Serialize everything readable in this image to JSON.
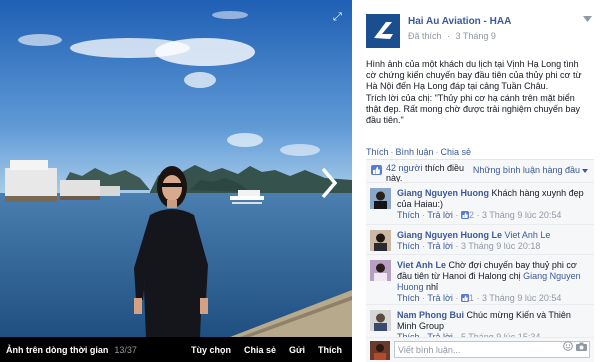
{
  "photo": {
    "album_link": "Ảnh trên dòng thời gian",
    "counter": "13/37",
    "actions": {
      "options": "Tùy chọn",
      "share": "Chia sẻ",
      "send": "Gửi",
      "like": "Thích"
    },
    "colors": {
      "sky_top": "#1f5fb4",
      "sky_bottom": "#8dbde6",
      "sea": "#2a5f93"
    }
  },
  "post": {
    "page_name": "Hai Au Aviation - HAA",
    "liked_label": "Đã thích",
    "dot": "·",
    "date": "3 Tháng 9",
    "caption_lines": [
      "Hình ảnh của một khách du lịch tại Vịnh Hạ Long tình cờ chứng kiến chuyến bay đầu tiên của thủy phi cơ từ Hà Nội đến Hạ Long đáp tại cảng Tuần Châu.",
      "Trích lời của chị: \"Thủy phi cơ hạ cánh trên mặt biển thật đẹp. Rất mong chờ được trải nghiệm chuyến bay đầu tiên.\""
    ],
    "actions": {
      "like": "Thích",
      "comment": "Bình luận",
      "share": "Chia sẻ",
      "sep": "·"
    }
  },
  "likes": {
    "count_link": "42 người",
    "count_text": "thích điều này.",
    "top_comments": "Những bình luận hàng đầu"
  },
  "comments": [
    {
      "author": "Giang Nguyen Huong",
      "text": "Khách hàng xuynh đẹp của Haiau:)",
      "mention": "",
      "text_after": "",
      "like": "Thích",
      "reply": "Trả lời",
      "likes": "2",
      "time": "3 Tháng 9 lúc 20:54"
    },
    {
      "author": "Giang Nguyen Huong Le",
      "text": "",
      "mention": "Viet Anh Le",
      "text_after": "",
      "like": "Thích",
      "reply": "Trả lời",
      "likes": "",
      "time": "3 Tháng 9 lúc 20:18"
    },
    {
      "author": "Viet Anh Le",
      "text": "Chờ đợi chuyến bay thuỷ phi cơ đầu tiên từ Hanoi đi Halong chị",
      "mention": "Giang Nguyen Huong",
      "text_after": "nhỉ",
      "like": "Thích",
      "reply": "Trả lời",
      "likes": "1",
      "time": "3 Tháng 9 lúc 20:54"
    },
    {
      "author": "Nam Phong Bui",
      "text": "Chúc mừng Kiến và Thiên Minh Group",
      "mention": "",
      "text_after": "",
      "like": "Thích",
      "reply": "Trả lời",
      "likes": "",
      "time": "5 Tháng 9 lúc 15:34"
    }
  ],
  "reply": {
    "placeholder": "Viết bình luận..."
  },
  "icons": [
    "expand-icon",
    "next-arrow-icon",
    "chevron-down-icon",
    "like-icon",
    "thumb-icon",
    "camera-icon",
    "emoji-icon"
  ]
}
